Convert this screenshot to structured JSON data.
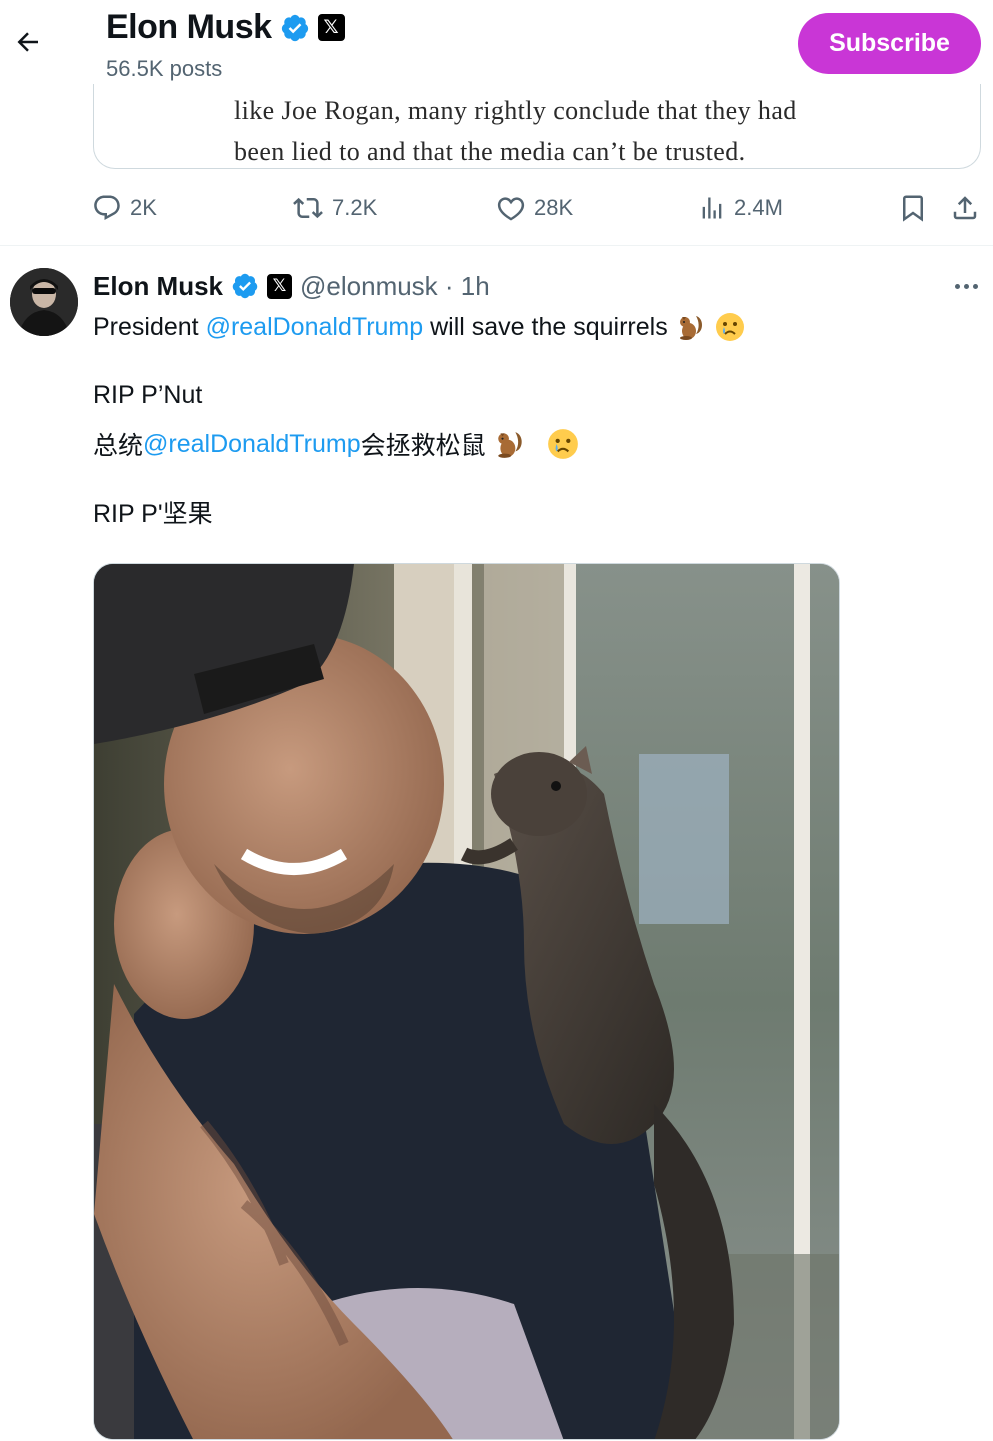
{
  "header": {
    "name": "Elon Musk",
    "posts": "56.5K posts",
    "subscribe_label": "Subscribe",
    "x_badge": "𝕏"
  },
  "quoted": {
    "line1": "like Joe Rogan, many rightly conclude that they had",
    "line2": "been lied to and that the media can’t be trusted."
  },
  "actions": {
    "replies": "2K",
    "reposts": "7.2K",
    "likes": "28K",
    "views": "2.4M"
  },
  "tweet": {
    "name": "Elon Musk",
    "x_badge": "𝕏",
    "handle_time": "@elonmusk · 1h",
    "line1_prefix": "President ",
    "mention": "@realDonaldTrump",
    "line1_suffix": " will save the squirrels",
    "line2": "RIP P’Nut",
    "line3_prefix": "总统",
    "line3_suffix": "会拯救松鼠",
    "line4": "RIP P'坚果"
  },
  "icons": {
    "back": "arrow-left-icon",
    "verified": "verified-badge-icon",
    "reply": "reply-icon",
    "repost": "repost-icon",
    "like": "heart-icon",
    "views": "views-icon",
    "bookmark": "bookmark-icon",
    "share": "share-icon",
    "more": "more-icon"
  },
  "colors": {
    "subscribe": "#c936d6",
    "mention": "#1d9bf0",
    "verified": "#1d9bf0",
    "muted": "#536471"
  }
}
